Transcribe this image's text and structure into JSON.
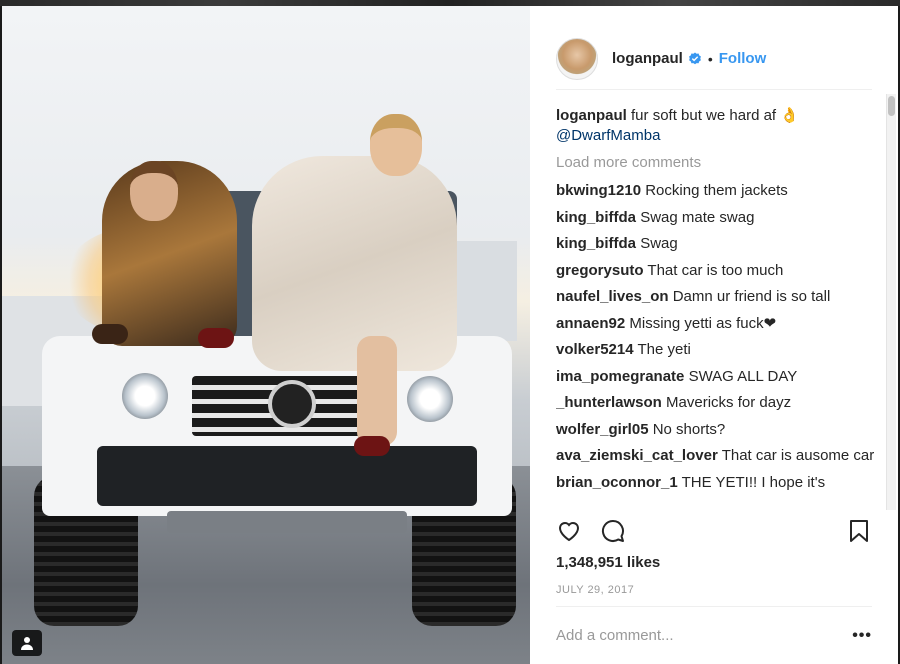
{
  "post": {
    "username": "loganpaul",
    "follow_label": "Follow",
    "dot": "•",
    "caption_user": "loganpaul",
    "caption_text": "fur soft but we hard af 👌",
    "caption_mention": "@DwarfMamba",
    "load_more": "Load more comments",
    "comments": [
      {
        "user": "bkwing1210",
        "text": "Rocking them jackets"
      },
      {
        "user": "king_biffda",
        "text": "Swag mate swag"
      },
      {
        "user": "king_biffda",
        "text": "Swag"
      },
      {
        "user": "gregorysuto",
        "text": "That car is too much"
      },
      {
        "user": "naufel_lives_on",
        "text": "Damn ur friend is so tall"
      },
      {
        "user": "annaen92",
        "text": "Missing yetti as fuck❤"
      },
      {
        "user": "volker5214",
        "text": "The yeti"
      },
      {
        "user": "ima_pomegranate",
        "text": "SWAG ALL DAY"
      },
      {
        "user": "_hunterlawson",
        "text": "Mavericks for dayz"
      },
      {
        "user": "wolfer_girl05",
        "text": "No shorts?"
      },
      {
        "user": "ava_ziemski_cat_lover",
        "text": "That car is ausome car"
      },
      {
        "user": "brian_oconnor_1",
        "text": "THE YETI!! I hope it's"
      }
    ],
    "likes": "1,348,951 likes",
    "date": "JULY 29, 2017",
    "add_comment_placeholder": "Add a comment...",
    "more_label": "•••"
  },
  "icons": {
    "verified": "verified-badge-icon",
    "like": "heart-icon",
    "comment": "comment-bubble-icon",
    "save": "bookmark-icon",
    "user_tag": "user-tag-icon"
  },
  "colors": {
    "accent": "#3897f0",
    "text": "#262626",
    "muted": "#999999",
    "mention": "#003569"
  }
}
